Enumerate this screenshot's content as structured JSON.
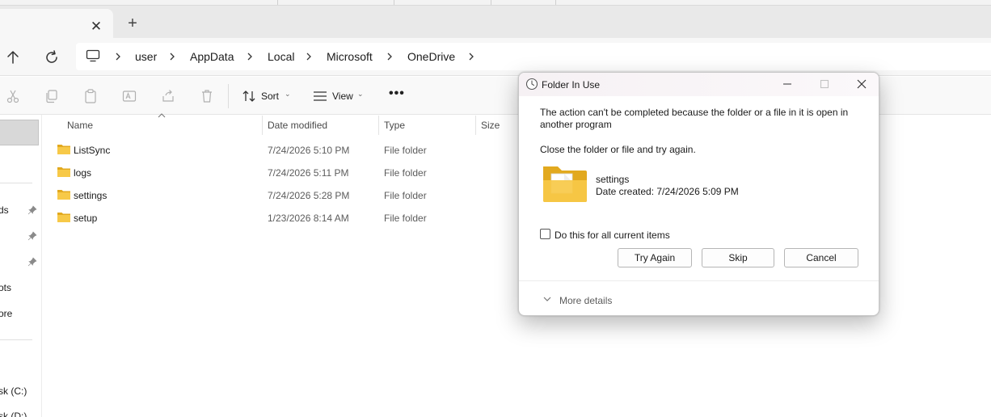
{
  "tab": {
    "close_glyph": "✕",
    "new_glyph": "+"
  },
  "breadcrumb": [
    "user",
    "AppData",
    "Local",
    "Microsoft",
    "OneDrive"
  ],
  "toolbar": {
    "sort_label": "Sort",
    "view_label": "View"
  },
  "sidebar": {
    "fragments": [
      "ds",
      "ots",
      "ore",
      "sk (C:)",
      "sk (D:)"
    ]
  },
  "columns": {
    "name": "Name",
    "date": "Date modified",
    "type": "Type",
    "size": "Size"
  },
  "files": [
    {
      "name": "ListSync",
      "date": "7/24/2026 5:10 PM",
      "type": "File folder"
    },
    {
      "name": "logs",
      "date": "7/24/2026 5:11 PM",
      "type": "File folder"
    },
    {
      "name": "settings",
      "date": "7/24/2026 5:28 PM",
      "type": "File folder"
    },
    {
      "name": "setup",
      "date": "1/23/2026 8:14 AM",
      "type": "File folder"
    }
  ],
  "dialog": {
    "title": "Folder In Use",
    "message": "The action can't be completed because the folder or a file in it is open in another program",
    "instruction": "Close the folder or file and try again.",
    "item_name": "settings",
    "item_created": "Date created: 7/24/2026 5:09 PM",
    "checkbox_label": "Do this for all current items",
    "try_again": "Try Again",
    "skip": "Skip",
    "cancel": "Cancel",
    "more_details": "More details"
  },
  "colors": {
    "folder_yellow": "#f7c948",
    "folder_dark": "#e2a91f"
  }
}
